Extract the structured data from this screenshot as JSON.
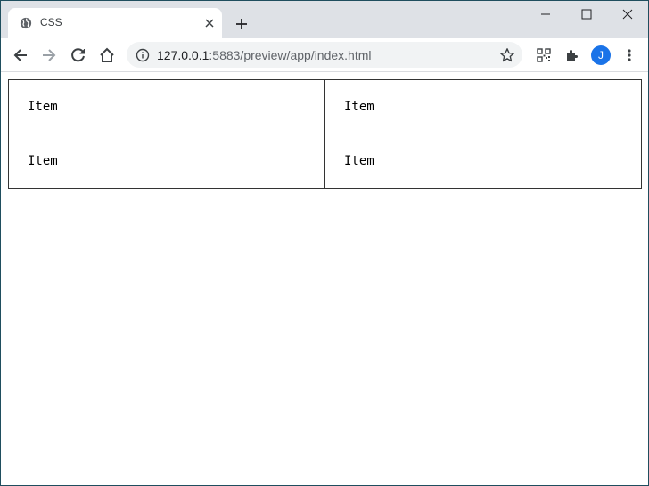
{
  "browser": {
    "tab": {
      "title": "CSS",
      "favicon": "globe-icon"
    },
    "omnibox": {
      "url_host": "127.0.0.1",
      "url_rest": ":5883/preview/app/index.html"
    },
    "profile_initial": "J",
    "icons": {
      "back": "back-arrow-icon",
      "forward": "forward-arrow-icon",
      "reload": "reload-icon",
      "home": "home-icon",
      "info": "info-icon",
      "bookmark": "star-icon",
      "qr": "qr-code-icon",
      "extensions": "puzzle-icon",
      "menu": "kebab-menu-icon"
    },
    "colors": {
      "accent": "#1a73e8",
      "tabstrip": "#dee1e6"
    }
  },
  "page": {
    "items": [
      {
        "label": "Item"
      },
      {
        "label": "Item"
      },
      {
        "label": "Item"
      },
      {
        "label": "Item"
      }
    ]
  }
}
